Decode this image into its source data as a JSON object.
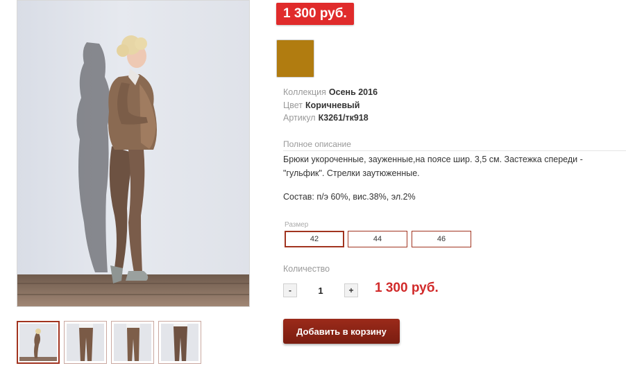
{
  "product": {
    "price_badge": "1 300 руб.",
    "swatch_color": "#b17c10",
    "meta": [
      {
        "key": "Коллекция",
        "value": "Осень 2016"
      },
      {
        "key": "Цвет",
        "value": "Коричневый"
      },
      {
        "key": "Артикул",
        "value": "К3261/тк918"
      }
    ],
    "description_label": "Полное описание",
    "description": "Брюки укороченные, зауженные,на поясе шир. 3,5 см. Застежка спереди - \"гульфик\". Стрелки заутюженные.",
    "composition": "Состав: п/э 60%, вис.38%, эл.2%",
    "size_label": "Размер",
    "sizes": [
      "42",
      "44",
      "46"
    ],
    "selected_size": "42",
    "quantity_label": "Количество",
    "qty_minus": "-",
    "qty_plus": "+",
    "quantity": "1",
    "price": "1 300 руб.",
    "add_to_cart": "Добавить в корзину"
  },
  "gallery": {
    "thumbnail_count": 4,
    "active_index": 0
  }
}
